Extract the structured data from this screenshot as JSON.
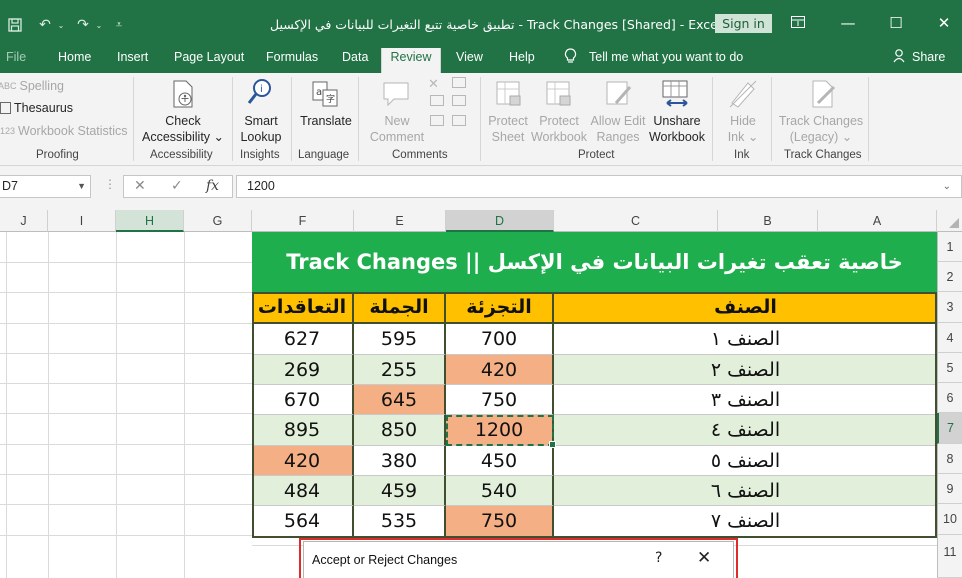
{
  "window": {
    "title": "تطبيق خاصية تتبع التغيرات للبيانات في الإكسيل - Track Changes  [Shared]  -  Excel",
    "sign_in": "Sign in",
    "minimize": "—",
    "restore": "☐",
    "close": "✕"
  },
  "tabs": [
    "File",
    "Home",
    "Insert",
    "Page Layout",
    "Formulas",
    "Data",
    "Review",
    "View",
    "Help"
  ],
  "active_tab": "Review",
  "tell_me": "Tell me what you want to do",
  "share": "Share",
  "ribbon": {
    "proofing": {
      "spelling": "Spelling",
      "thesaurus": "Thesaurus",
      "workbook_statistics": "Workbook Statistics",
      "label": "Proofing"
    },
    "accessibility": {
      "check_line1": "Check",
      "check_line2": "Accessibility ⌄",
      "label": "Accessibility"
    },
    "insights": {
      "smart_line1": "Smart",
      "smart_line2": "Lookup",
      "label": "Insights"
    },
    "language": {
      "translate": "Translate",
      "label": "Language"
    },
    "comments": {
      "new_line1": "New",
      "new_line2": "Comment",
      "label": "Comments"
    },
    "protect": {
      "protect_sheet_1": "Protect",
      "protect_sheet_2": "Sheet",
      "protect_workbook_1": "Protect",
      "protect_workbook_2": "Workbook",
      "allow_edit_1": "Allow Edit",
      "allow_edit_2": "Ranges",
      "unshare_1": "Unshare",
      "unshare_2": "Workbook",
      "label": "Protect"
    },
    "ink": {
      "hide_1": "Hide",
      "hide_2": "Ink ⌄",
      "label": "Ink"
    },
    "track_changes": {
      "tc_1": "Track Changes",
      "tc_2": "(Legacy) ⌄",
      "label": "Track Changes"
    }
  },
  "formula_bar": {
    "name_box": "D7",
    "value": "1200",
    "fx": "fx"
  },
  "columns": [
    "J",
    "I",
    "H",
    "G",
    "F",
    "E",
    "D",
    "C",
    "B",
    "A"
  ],
  "rows": [
    "1",
    "2",
    "3",
    "4",
    "5",
    "6",
    "7",
    "8",
    "9",
    "10",
    "11"
  ],
  "table": {
    "banner": "خاصية تعقب تغيرات البيانات في الإكسل || Track Changes",
    "headers": {
      "category": "الصنف",
      "retail": "التجزئة",
      "wholesale": "الجملة",
      "contracts": "التعاقدات"
    },
    "rows": [
      {
        "category": "الصنف ١",
        "retail": "700",
        "wholesale": "595",
        "contracts": "627"
      },
      {
        "category": "الصنف ٢",
        "retail": "420",
        "wholesale": "255",
        "contracts": "269"
      },
      {
        "category": "الصنف ٣",
        "retail": "750",
        "wholesale": "645",
        "contracts": "670"
      },
      {
        "category": "الصنف ٤",
        "retail": "1200",
        "wholesale": "850",
        "contracts": "895"
      },
      {
        "category": "الصنف ٥",
        "retail": "450",
        "wholesale": "380",
        "contracts": "420"
      },
      {
        "category": "الصنف ٦",
        "retail": "540",
        "wholesale": "459",
        "contracts": "484"
      },
      {
        "category": "الصنف ٧",
        "retail": "750",
        "wholesale": "535",
        "contracts": "564"
      }
    ],
    "colors": {
      "banner": "#1eae4d",
      "header": "#ffc000",
      "changed": "#f4b084",
      "band": "#e2efda"
    }
  },
  "dialog": {
    "title": "Accept or Reject Changes",
    "help": "?",
    "close": "✕"
  }
}
